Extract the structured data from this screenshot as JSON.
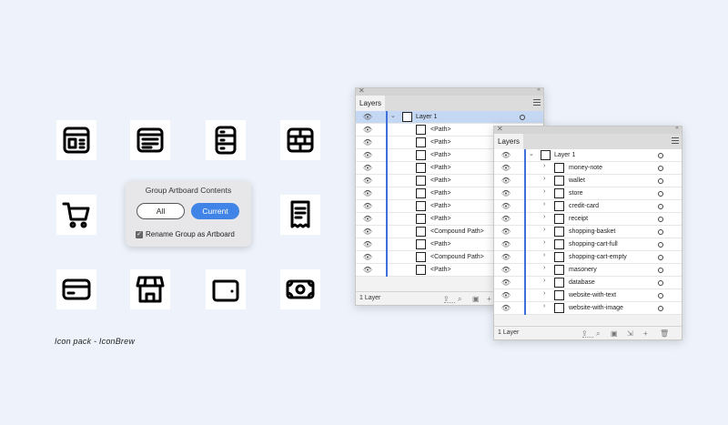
{
  "caption": "Icon pack - IconBrew",
  "icons": [
    "layout-icon",
    "browser-window-icon",
    "database-icon",
    "masonry-icon",
    "shopping-cart-icon",
    "receipt-icon",
    "credit-card-icon",
    "store-icon",
    "wallet-icon",
    "money-note-icon"
  ],
  "dialog": {
    "title": "Group Artboard Contents",
    "option_all": "All",
    "option_current": "Current",
    "checkbox_label": "Rename Group as Artboard",
    "checkbox_checked": true
  },
  "panel_back": {
    "tab": "Layers",
    "layer_name": "Layer 1",
    "rows": [
      "<Path>",
      "<Path>",
      "<Path>",
      "<Path>",
      "<Path>",
      "<Path>",
      "<Path>",
      "<Path>",
      "<Compound Path>",
      "<Path>",
      "<Compound Path>",
      "<Path>"
    ],
    "footer": "1 Layer"
  },
  "panel_front": {
    "tab": "Layers",
    "layer_name": "Layer 1",
    "rows": [
      "money-note",
      "wallet",
      "store",
      "credit-card",
      "receipt",
      "shopping-basket",
      "shopping-cart-full",
      "shopping-cart-empty",
      "masonery",
      "database",
      "website-with-text",
      "website-with-image"
    ],
    "footer": "1 Layer"
  },
  "accent_color": "#3f84e6",
  "selection_color": "#c4d7f3"
}
